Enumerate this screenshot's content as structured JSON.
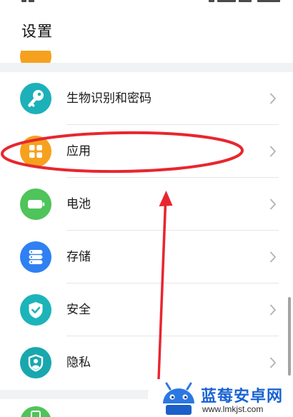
{
  "header": {
    "title": "设置"
  },
  "settings": {
    "items": [
      {
        "label": "生物识别和密码",
        "icon": "key-icon",
        "color": "#1cb1b9"
      },
      {
        "label": "应用",
        "icon": "apps-grid-icon",
        "color": "#f6a11d"
      },
      {
        "label": "电池",
        "icon": "battery-icon",
        "color": "#4ec45a"
      },
      {
        "label": "存储",
        "icon": "storage-icon",
        "color": "#2f80f2"
      },
      {
        "label": "安全",
        "icon": "shield-check-icon",
        "color": "#1cb4b9"
      },
      {
        "label": "隐私",
        "icon": "privacy-shield-icon",
        "color": "#19a7ae"
      }
    ],
    "partial_above": {
      "icon": "partial-icon",
      "color": "#f6a11d"
    },
    "partial_below": {
      "icon": "partial-icon",
      "color": "#4ec45a"
    }
  },
  "annotation": {
    "color": "#e8262f"
  },
  "watermark": {
    "brand": "蓝莓安卓网",
    "url": "www.lmkjst.com",
    "color": "#1a63d3",
    "logo_color": "#2a78e4"
  }
}
